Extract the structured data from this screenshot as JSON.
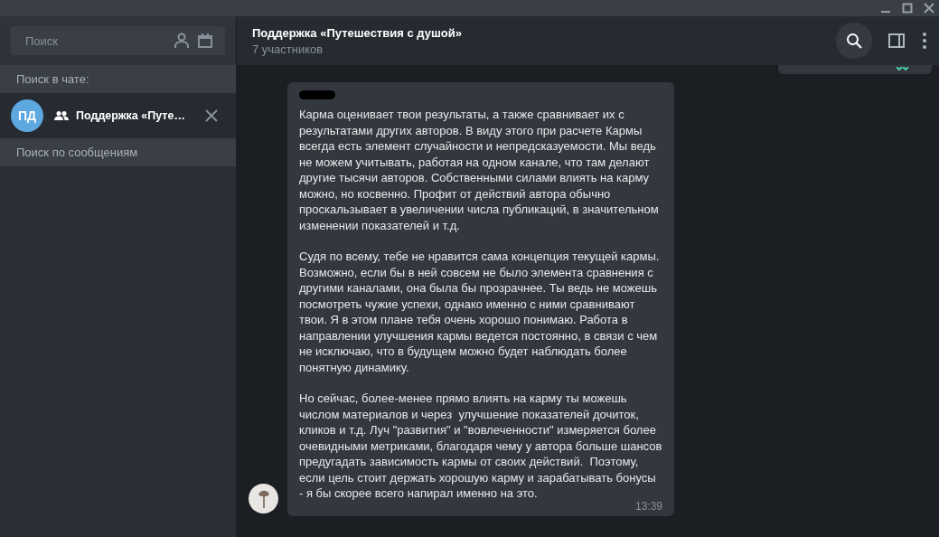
{
  "sidebar": {
    "search": {
      "placeholder": "Поиск"
    },
    "search_in_chat_label": "Поиск в чате:",
    "chat": {
      "initials": "ПД",
      "name": "Поддержка «Путе…"
    },
    "search_messages": "Поиск по сообщениям"
  },
  "header": {
    "title": "Поддержка «Путешествия с душой»",
    "subtitle": "7 участников",
    "search_active": true
  },
  "messages": [
    {
      "paragraphs": [
        "Карма оценивает твои результаты, а также сравнивает их с результатами других авторов. В виду этого при расчете Кармы всегда есть элемент случайности и непредсказуемости. Мы ведь не можем учитывать, работая на одном канале, что там делают другие тысячи авторов. Собственными силами влиять на карму можно, но косвенно. Профит от действий автора обычно проскальзывает в увеличении числа публикаций, в значительном изменении показателей и т.д.",
        "Судя по всему, тебе не нравится сама концепция текущей кармы. Возможно, если бы в ней совсем не было элемента сравнения с другими каналами, она была бы прозрачнее. Ты ведь не можешь посмотреть чужие успехи, однако именно с ними сравнивают твои. Я в этом плане тебя очень хорошо понимаю. Работа в направлении улучшения кармы ведется постоянно, в связи с чем не исключаю, что в будущем можно будет наблюдать более понятную динамику.",
        "Но сейчас, более-менее прямо влиять на карму ты можешь числом материалов и через  улучшение показателей дочиток, кликов и т.д. Луч \"развития\" и \"вовлеченности\" измеряется более очевидными метриками, благодаря чему у автора больше шансов предугадать зависимость кармы от своих действий.  Поэтому, если цель стоит держать хорошую карму и зарабатывать бонусы - я бы скорее всего напирал именно на это."
      ],
      "time": "13:39"
    }
  ]
}
